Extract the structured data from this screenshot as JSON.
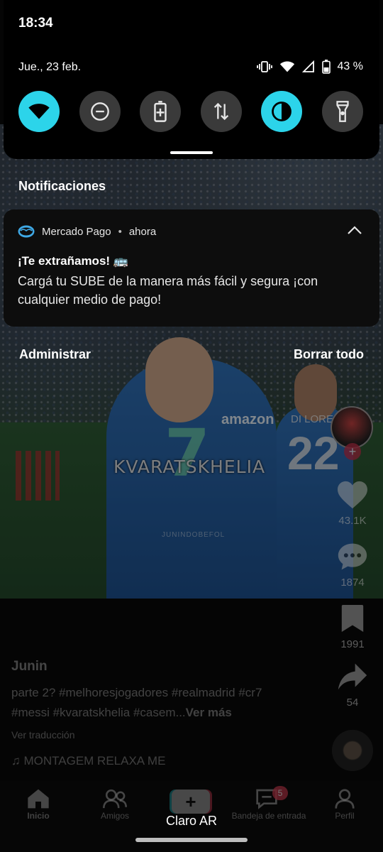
{
  "status_bar": {
    "time": "18:34",
    "date": "Jue., 23 feb.",
    "battery": "43 %"
  },
  "quick_tiles": [
    {
      "name": "wifi",
      "icon": "wifi-icon",
      "active": true
    },
    {
      "name": "do-not-disturb",
      "icon": "dnd-icon",
      "active": false
    },
    {
      "name": "battery-saver",
      "icon": "battery-saver-icon",
      "active": false
    },
    {
      "name": "mobile-data",
      "icon": "data-arrows-icon",
      "active": false
    },
    {
      "name": "dark-theme",
      "icon": "contrast-icon",
      "active": true
    },
    {
      "name": "flashlight",
      "icon": "flashlight-icon",
      "active": false
    }
  ],
  "notifications": {
    "heading": "Notificaciones",
    "items": [
      {
        "app": "Mercado Pago",
        "time": "ahora",
        "title": "¡Te extrañamos! 🚌",
        "body": "Cargá tu SUBE de la manera más fácil y segura ¡con cualquier medio de pago!"
      }
    ],
    "manage_label": "Administrar",
    "clear_label": "Borrar todo"
  },
  "video": {
    "overlay_text": "KVARATSKHELIA",
    "watermark": "JUNINDOBEFOL",
    "jersey_number": "7",
    "jersey_sponsor": "amazon",
    "second_number": "22",
    "second_name": "DI LORENZ",
    "likes": "43.1K",
    "comments": "1874",
    "saves": "1991",
    "shares": "54",
    "username": "Junin",
    "caption": "parte 2? #melhoresjogadores #realmadrid #cr7 #messi #kvaratskhelia #casem...",
    "see_more": "Ver más",
    "see_translation": "Ver traducción",
    "music": "♫ MONTAGEM RELAXA ME"
  },
  "bottom_nav": {
    "home": "Inicio",
    "friends": "Amigos",
    "create": "+",
    "inbox": "Bandeja de entrada",
    "inbox_badge": "5",
    "profile": "Perfil"
  },
  "carrier": "Claro AR",
  "colors": {
    "accent_tile": "#2cd4ea",
    "shade_bg": "#000000",
    "badge": "#c3384c"
  }
}
